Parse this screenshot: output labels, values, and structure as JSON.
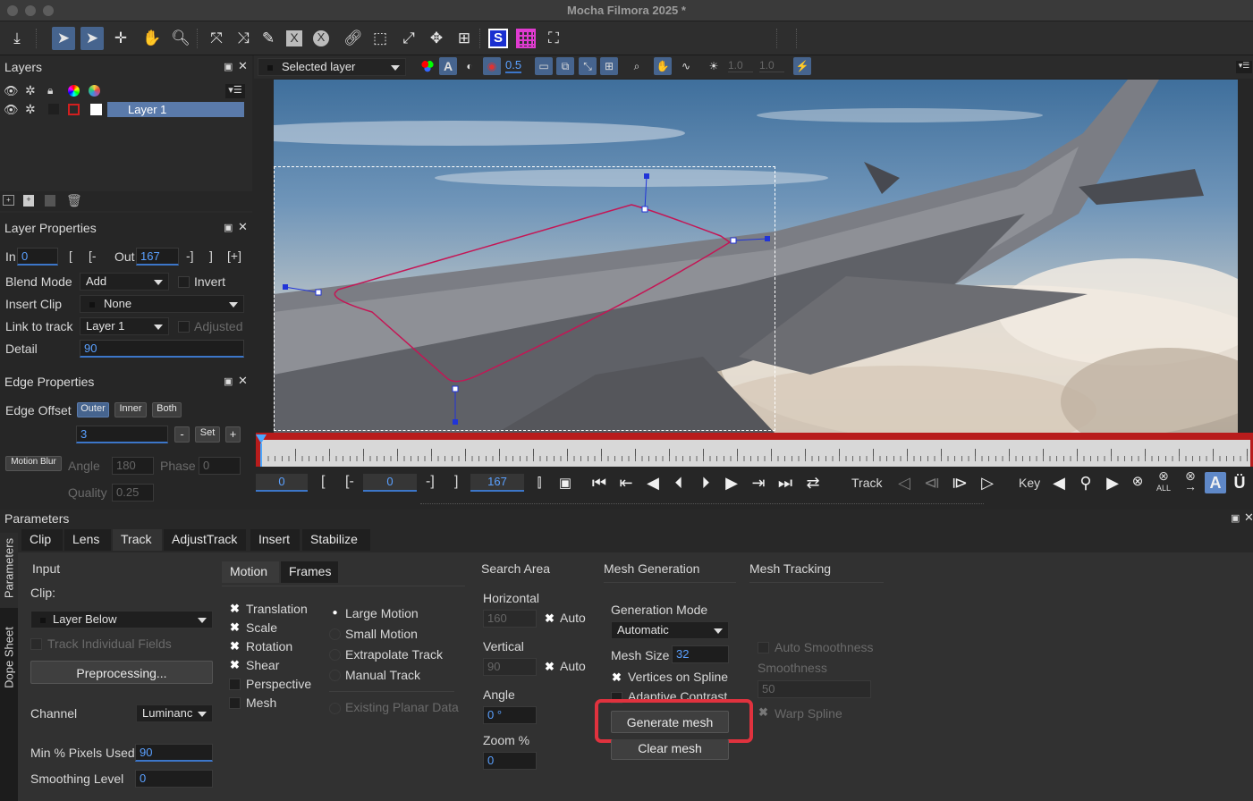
{
  "window": {
    "title": "Mocha Filmora 2025 *"
  },
  "toolbar": {
    "tools": [
      "download-icon",
      "select-arrow-icon",
      "select-points-icon",
      "add-point-icon",
      "pan-hand-icon",
      "zoom-icon",
      "xspline-icon",
      "bezier-icon",
      "brush-icon",
      "erase-x-icon",
      "x-circle-icon",
      "link-icon",
      "transform-icon",
      "scale-icon",
      "move-icon",
      "grid-icon",
      "surface-icon",
      "grid-view-icon",
      "fit-icon"
    ],
    "surface_label": "S"
  },
  "layers": {
    "title": "Layers",
    "items": [
      {
        "name": "Layer 1",
        "color": "#d21f1f"
      }
    ]
  },
  "layer_properties": {
    "title": "Layer Properties",
    "in_label": "In",
    "in_value": "0",
    "bracket_labels": [
      "[",
      "[-",
      "-]",
      "]",
      "[+]"
    ],
    "out_label": "Out",
    "out_value": "167",
    "blend_mode_label": "Blend Mode",
    "blend_mode_value": "Add",
    "invert_label": "Invert",
    "insert_clip_label": "Insert Clip",
    "insert_clip_value": "None",
    "link_label": "Link to track",
    "link_value": "Layer 1",
    "adjusted_label": "Adjusted",
    "detail_label": "Detail",
    "detail_value": "90"
  },
  "edge_properties": {
    "title": "Edge Properties",
    "offset_label": "Edge Offset",
    "buttons": [
      "Outer",
      "Inner",
      "Both"
    ],
    "offset_value": "3",
    "minus": "-",
    "set": "Set",
    "plus": "+",
    "motion_blur_label": "Motion Blur",
    "angle_label": "Angle",
    "angle_value": "180",
    "phase_label": "Phase",
    "phase_value": "0",
    "quality_label": "Quality",
    "quality_value": "0.25"
  },
  "viewer": {
    "layer_select": "Selected layer",
    "opacity_value": "0.5",
    "exposure_value": "1.0",
    "gamma_value": "1.0"
  },
  "timeline": {
    "current_frame": "0",
    "in_frame": "0",
    "out_frame": "167",
    "brackets": [
      "[",
      "[-",
      "-]",
      "]"
    ],
    "track_label": "Track",
    "key_label": "Key",
    "all_label": "ALL"
  },
  "parameters": {
    "title": "Parameters",
    "side_tabs": [
      "Parameters",
      "Dope Sheet"
    ],
    "tabs": [
      "Clip",
      "Lens",
      "Track",
      "AdjustTrack",
      "Insert",
      "Stabilize"
    ],
    "selected_tab": "Track",
    "input": {
      "title": "Input",
      "clip_label": "Clip:",
      "clip_value": "Layer Below",
      "track_fields_label": "Track Individual Fields",
      "preprocessing_label": "Preprocessing...",
      "channel_label": "Channel",
      "channel_value": "Luminanc",
      "min_pixels_label": "Min % Pixels Used",
      "min_pixels_value": "90",
      "smoothing_label": "Smoothing Level",
      "smoothing_value": "0"
    },
    "motion": {
      "tabs": [
        "Motion",
        "Frames"
      ],
      "checks": [
        {
          "label": "Translation",
          "checked": true
        },
        {
          "label": "Scale",
          "checked": true
        },
        {
          "label": "Rotation",
          "checked": true
        },
        {
          "label": "Shear",
          "checked": true
        },
        {
          "label": "Perspective",
          "checked": false
        },
        {
          "label": "Mesh",
          "checked": false
        }
      ],
      "radios": [
        {
          "label": "Large Motion",
          "selected": true
        },
        {
          "label": "Small Motion",
          "selected": false
        },
        {
          "label": "Extrapolate Track",
          "selected": false
        },
        {
          "label": "Manual Track",
          "selected": false
        }
      ],
      "existing_planar": "Existing Planar Data"
    },
    "search_area": {
      "title": "Search Area",
      "horizontal_label": "Horizontal",
      "horizontal_value": "160",
      "auto_label": "Auto",
      "vertical_label": "Vertical",
      "vertical_value": "90",
      "angle_label": "Angle",
      "angle_value": "0 °",
      "zoom_label": "Zoom %",
      "zoom_value": "0"
    },
    "mesh_generation": {
      "title": "Mesh Generation",
      "mode_label": "Generation Mode",
      "mode_value": "Automatic",
      "mesh_size_label": "Mesh Size",
      "mesh_size_value": "32",
      "vertices_label": "Vertices on Spline",
      "adaptive_label": "Adaptive Contrast",
      "generate_label": "Generate mesh",
      "clear_label": "Clear mesh"
    },
    "mesh_tracking": {
      "title": "Mesh Tracking",
      "auto_smooth_label": "Auto Smoothness",
      "smoothness_label": "Smoothness",
      "smoothness_value": "50",
      "warp_label": "Warp Spline"
    }
  },
  "colors": {
    "accent": "#46648e",
    "field_text": "#5aa0ff",
    "highlight": "#e0323e",
    "timeline_red": "#b81c1c"
  }
}
